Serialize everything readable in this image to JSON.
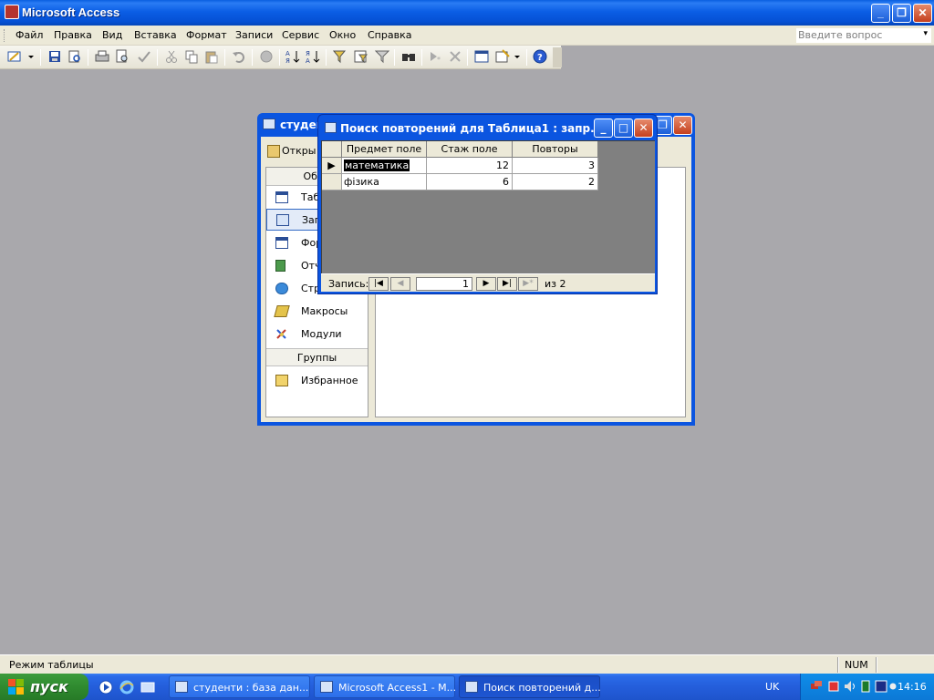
{
  "app": {
    "title": "Microsoft Access",
    "min_symbol": "_",
    "max_symbol": "❐",
    "close_symbol": "✕"
  },
  "menu": {
    "items": [
      "Файл",
      "Правка",
      "Вид",
      "Вставка",
      "Формат",
      "Записи",
      "Сервис",
      "Окно",
      "Справка"
    ],
    "ask_placeholder": "Введите вопрос"
  },
  "toolbar": {
    "icons": [
      "view-icon",
      "save-icon",
      "search-file-icon",
      "print-icon",
      "print-preview-icon",
      "spelling-icon",
      "cut-icon",
      "copy-icon",
      "paste-icon",
      "undo-icon",
      "insert-object-icon",
      "sort-ascending-icon",
      "sort-descending-icon",
      "filter-by-selection-icon",
      "filter-by-form-icon",
      "apply-filter-icon",
      "find-icon",
      "new-record-icon",
      "delete-record-icon",
      "database-window-icon",
      "new-object-icon",
      "help-icon"
    ]
  },
  "db_window": {
    "title": "студен",
    "open_label": "Откры",
    "objects_header": "Объе",
    "objects": [
      {
        "label": "Табл",
        "icon": "table-icon"
      },
      {
        "label": "Запр",
        "icon": "query-icon"
      },
      {
        "label": "Фор",
        "icon": "form-icon"
      },
      {
        "label": "Отч",
        "icon": "report-icon"
      },
      {
        "label": "Стр",
        "icon": "page-icon"
      },
      {
        "label": "Макросы",
        "icon": "macro-icon"
      },
      {
        "label": "Модули",
        "icon": "module-icon"
      }
    ],
    "groups_header": "Группы",
    "groups": [
      {
        "label": "Избранное",
        "icon": "favorites-icon"
      }
    ]
  },
  "query_window": {
    "title": "Поиск повторений для Таблица1 : запр...",
    "columns": [
      "Предмет поле",
      "Стаж поле",
      "Повторы"
    ],
    "rows": [
      {
        "subject": "математика",
        "experience": "12",
        "repeats": "3"
      },
      {
        "subject": "фізика",
        "experience": "6",
        "repeats": "2"
      }
    ],
    "nav": {
      "label": "Запись:",
      "current": "1",
      "of_label": "из",
      "total": "2"
    }
  },
  "status": {
    "mode": "Режим таблицы",
    "num": "NUM"
  },
  "taskbar": {
    "start_label": "пуск",
    "tasks": [
      {
        "label": "студенти : база дан..."
      },
      {
        "label": "Microsoft Access1 - M..."
      },
      {
        "label": "Поиск повторений д..."
      }
    ],
    "lang": "UK",
    "clock": "14:16"
  }
}
